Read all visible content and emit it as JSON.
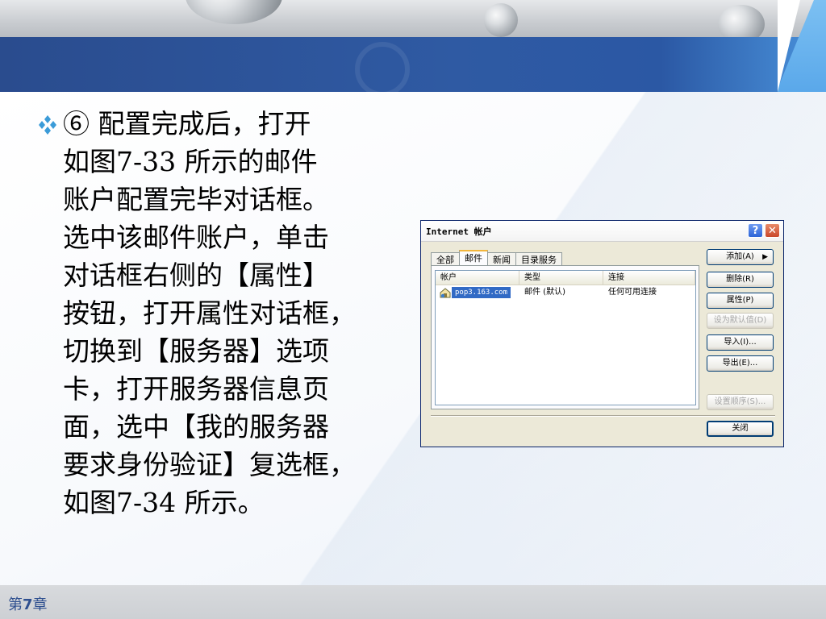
{
  "slide": {
    "body_text": "⑥ 配置完成后，打开\n如图7-33 所示的邮件\n账户配置完毕对话框。\n选中该邮件账户，单击\n对话框右侧的【属性】\n按钮，打开属性对话框，\n切换到【服务器】选项\n卡，打开服务器信息页\n面，选中【我的服务器\n要求身份验证】复选框，\n如图7-34 所示。",
    "bullet_icon": "diamond-bullet-icon",
    "footer_prefix": "第",
    "footer_num": "7",
    "footer_suffix": "章"
  },
  "dialog": {
    "title": "Internet 帐户",
    "help_label": "?",
    "close_label": "✕",
    "tabs": [
      {
        "label": "全部",
        "active": false
      },
      {
        "label": "邮件",
        "active": true
      },
      {
        "label": "新闻",
        "active": false
      },
      {
        "label": "目录服务",
        "active": false
      }
    ],
    "columns": [
      "帐户",
      "类型",
      "连接"
    ],
    "rows": [
      {
        "account": "pop3.163.com",
        "type": "邮件 (默认)",
        "connection": "任何可用连接"
      }
    ],
    "buttons": {
      "add": "添加(A)",
      "add_arrow": "▶",
      "remove": "删除(R)",
      "properties": "属性(P)",
      "set_default": "设为默认值(D)",
      "import": "导入(I)...",
      "export": "导出(E)...",
      "set_order": "设置顺序(S)...",
      "close": "关闭"
    }
  },
  "colors": {
    "banner_blue": "#2f5aa3",
    "selection_blue": "#316ac5",
    "dialog_face": "#ece9d8",
    "footer_text": "#2e4f8f"
  }
}
